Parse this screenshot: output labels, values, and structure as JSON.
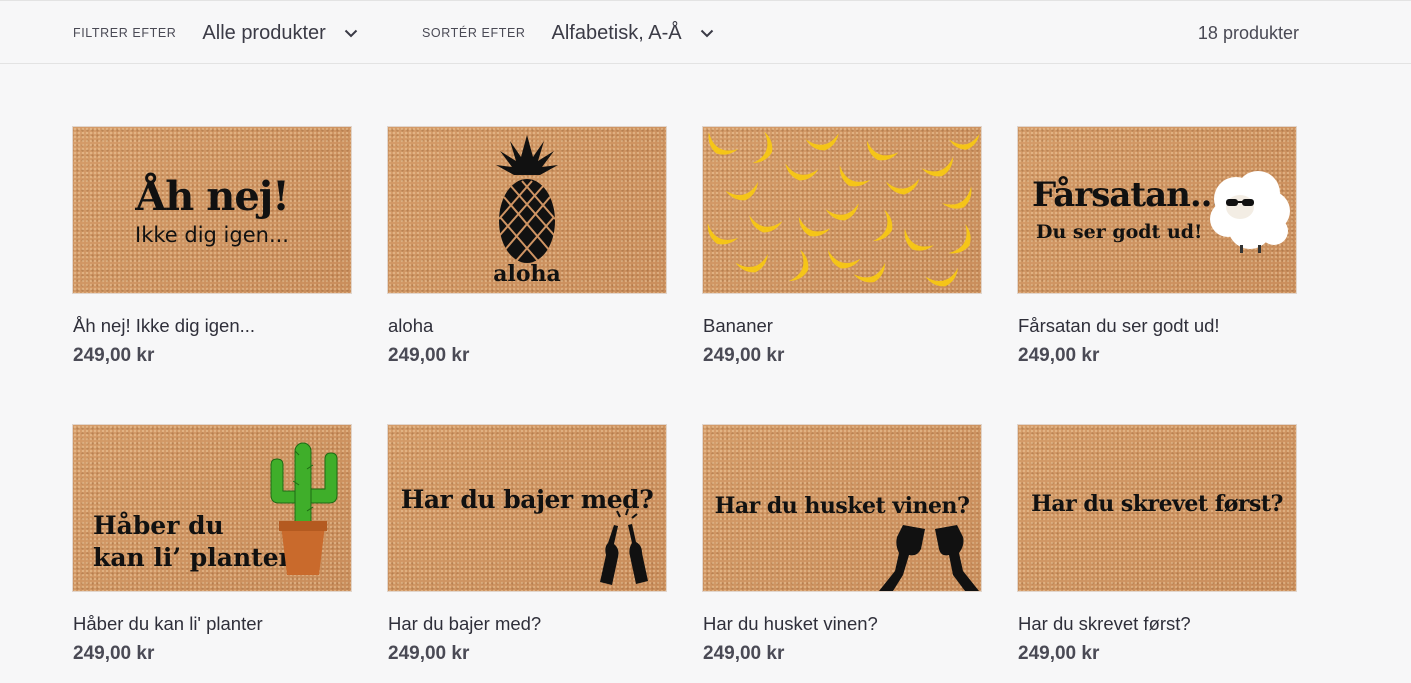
{
  "filter": {
    "filter_label": "FILTRER EFTER",
    "filter_value": "Alle produkter",
    "sort_label": "SORTÉR EFTER",
    "sort_value": "Alfabetisk, A-Å",
    "count": "18 produkter"
  },
  "products": [
    {
      "title": "Åh nej! Ikke dig igen...",
      "price": "249,00 kr",
      "mat_line1": "Åh nej!",
      "mat_line2": "Ikke dig igen..."
    },
    {
      "title": "aloha",
      "price": "249,00 kr",
      "mat_line1": "aloha"
    },
    {
      "title": "Bananer",
      "price": "249,00 kr"
    },
    {
      "title": "Fårsatan du ser godt ud!",
      "price": "249,00 kr",
      "mat_line1": "Fårsatan...",
      "mat_line2": "Du ser godt ud!"
    },
    {
      "title": "Håber du kan li' planter",
      "price": "249,00 kr",
      "mat_line1": "Håber du",
      "mat_line2": "kan li’ planter"
    },
    {
      "title": "Har du bajer med?",
      "price": "249,00 kr",
      "mat_line1": "Har du bajer med?"
    },
    {
      "title": "Har du husket vinen?",
      "price": "249,00 kr",
      "mat_line1": "Har du husket vinen?"
    },
    {
      "title": "Har du skrevet først?",
      "price": "249,00 kr",
      "mat_line1": "Har du skrevet først?"
    }
  ],
  "colors": {
    "background": "#f7f7f8",
    "mat": "#cf9463",
    "banana": "#f5c518",
    "cactus": "#3fae2a",
    "pot": "#c96a2c"
  },
  "icons": {
    "dropdown": "chevron-down-icon",
    "pineapple": "pineapple-icon",
    "banana": "banana-icon",
    "sheep": "sheep-icon",
    "cactus": "cactus-icon",
    "bottles": "beer-bottles-icon",
    "wine": "wine-glasses-icon"
  }
}
